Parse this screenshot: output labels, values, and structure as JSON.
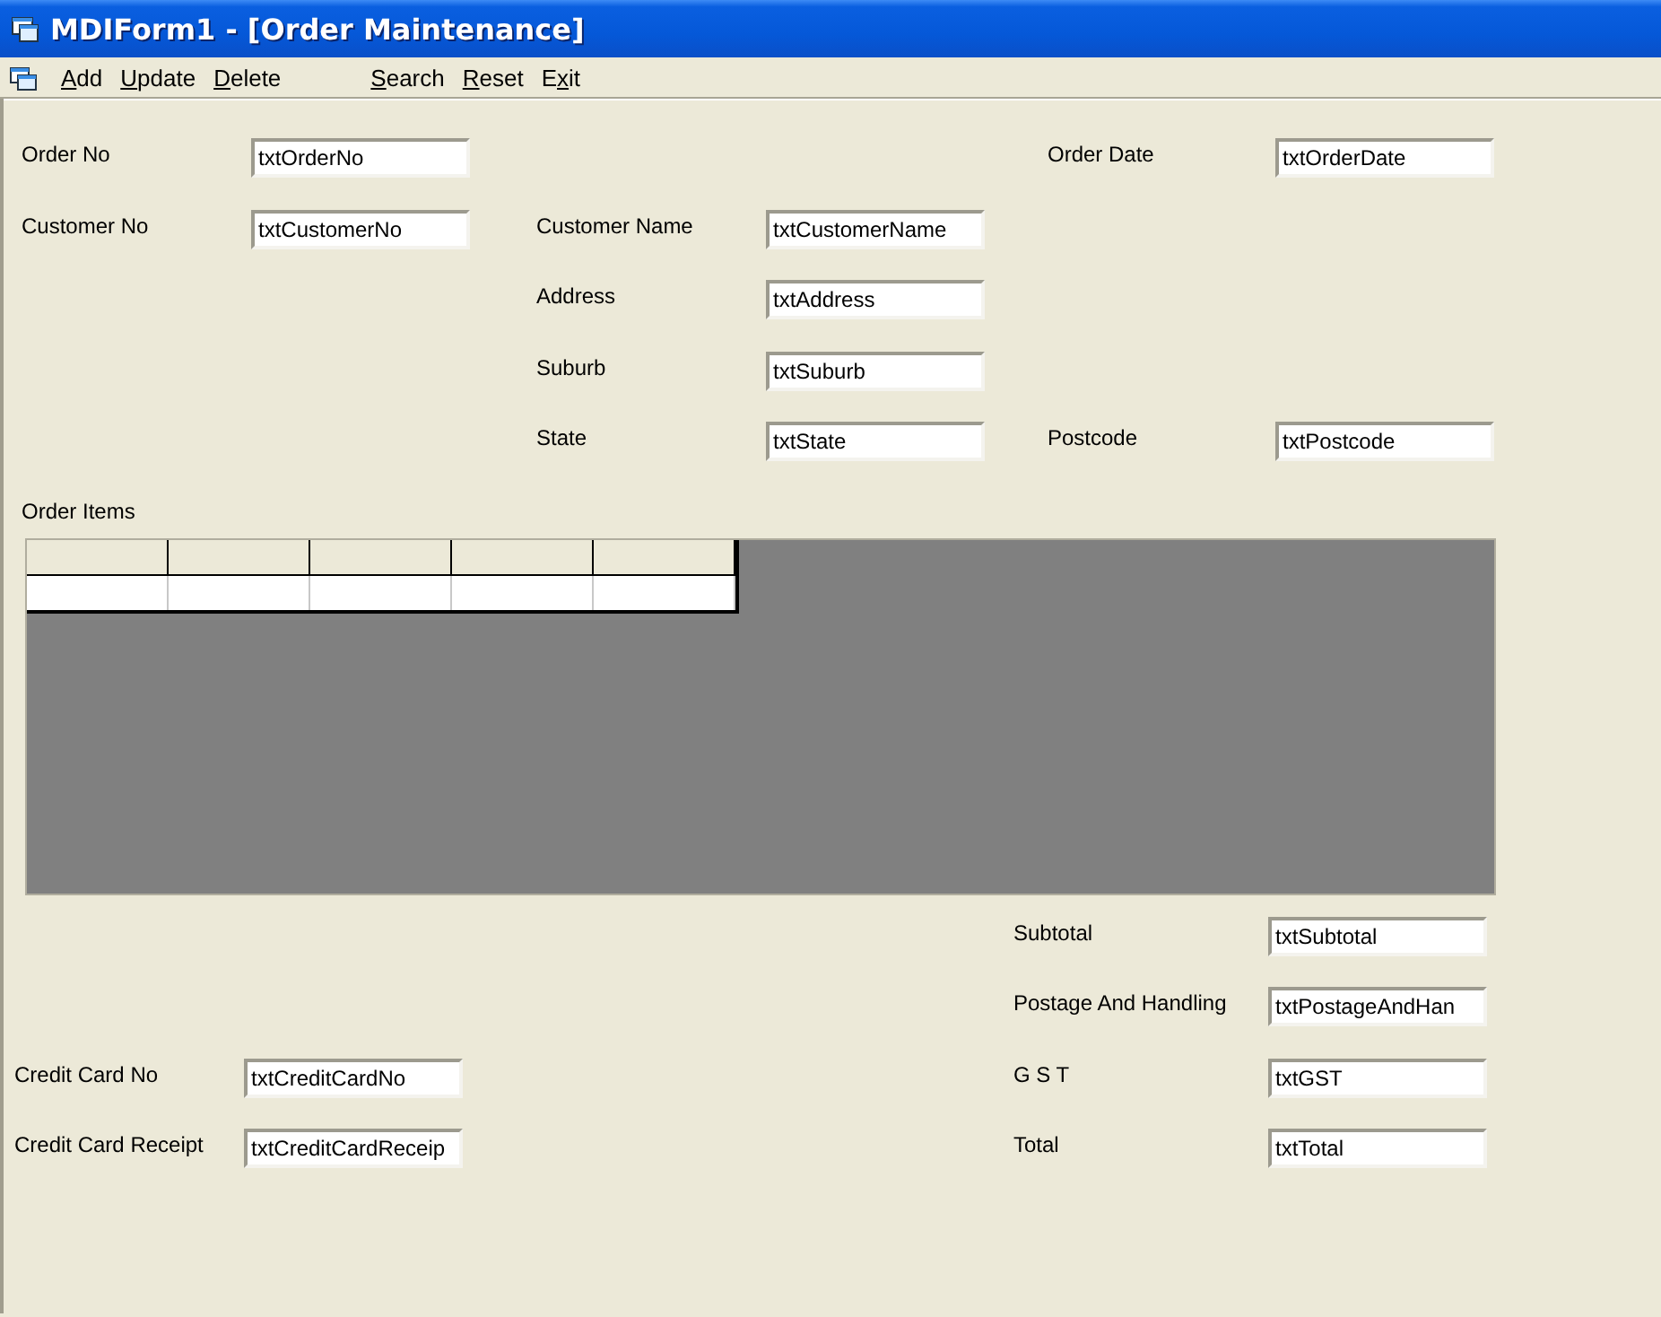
{
  "window": {
    "title": "MDIForm1 - [Order Maintenance]"
  },
  "menu": [
    {
      "kind": "item",
      "access_key": "A",
      "after_key": "dd"
    },
    {
      "kind": "item",
      "access_key": "U",
      "after_key": "pdate"
    },
    {
      "kind": "item",
      "access_key": "D",
      "after_key": "elete"
    },
    {
      "kind": "gap"
    },
    {
      "kind": "item",
      "access_key": "S",
      "after_key": "earch"
    },
    {
      "kind": "item",
      "access_key": "R",
      "after_key": "eset"
    },
    {
      "kind": "item",
      "before_key": "E",
      "access_key": "x",
      "after_key": "it"
    }
  ],
  "header_rows": [
    {
      "cells": [
        {
          "kind": "field",
          "label": "Order No",
          "value": "txtOrderNo"
        },
        {
          "kind": "blank"
        },
        {
          "kind": "field",
          "label": "Order Date",
          "value": "txtOrderDate"
        }
      ]
    },
    {
      "cells": [
        {
          "kind": "field",
          "label": "Customer No",
          "value": "txtCustomerNo"
        },
        {
          "kind": "field",
          "label": "Customer Name",
          "value": "txtCustomerName"
        },
        {
          "kind": "blank"
        }
      ]
    },
    {
      "cells": [
        {
          "kind": "blank"
        },
        {
          "kind": "field",
          "label": "Address",
          "value": "txtAddress"
        },
        {
          "kind": "blank"
        }
      ]
    },
    {
      "cells": [
        {
          "kind": "blank"
        },
        {
          "kind": "field",
          "label": "Suburb",
          "value": "txtSuburb"
        },
        {
          "kind": "blank"
        }
      ]
    },
    {
      "cells": [
        {
          "kind": "blank"
        },
        {
          "kind": "field",
          "label": "State",
          "value": "txtState"
        },
        {
          "kind": "field",
          "label": "Postcode",
          "value": "txtPostcode"
        }
      ]
    }
  ],
  "order_items": {
    "label": "Order Items",
    "columns": [
      {
        "kind": "blank"
      },
      {
        "kind": "blank"
      },
      {
        "kind": "blank"
      },
      {
        "kind": "blank"
      },
      {
        "kind": "blank"
      }
    ]
  },
  "footer_rows": [
    {
      "cells": [
        {
          "kind": "blank"
        },
        {
          "kind": "field",
          "label": "Subtotal",
          "value": "txtSubtotal"
        }
      ]
    },
    {
      "cells": [
        {
          "kind": "blank"
        },
        {
          "kind": "field",
          "label": "Postage And Handling",
          "value": "txtPostageAndHan"
        }
      ]
    },
    {
      "cells": [
        {
          "kind": "field",
          "label": "Credit Card No",
          "value": "txtCreditCardNo"
        },
        {
          "kind": "field",
          "label": "G S T",
          "value": "txtGST"
        }
      ]
    },
    {
      "cells": [
        {
          "kind": "field",
          "label": "Credit Card Receipt",
          "value": "txtCreditCardReceip"
        },
        {
          "kind": "field",
          "label": "Total",
          "value": "txtTotal"
        }
      ]
    }
  ]
}
